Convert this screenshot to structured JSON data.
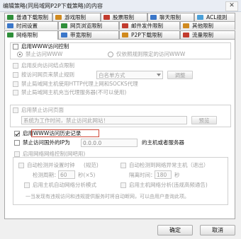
{
  "window": {
    "title": "编辑策略(同局域网P2P下载策略)的内容",
    "close": "✕"
  },
  "tabs_row1": [
    {
      "label": "普通下载限制",
      "color": "#2f8f3a"
    },
    {
      "label": "游戏限制",
      "color": "#d08a1f"
    },
    {
      "label": "股票限制",
      "color": "#c23b2e"
    },
    {
      "label": "聊天限制",
      "color": "#3b77c9"
    },
    {
      "label": "ACL规则",
      "color": "#4aa0d8"
    }
  ],
  "tabs_row2": [
    {
      "label": "时间设置",
      "color": "#3b77c9"
    },
    {
      "label": "网页浏览限制",
      "color": "#2f8f3a"
    },
    {
      "label": "邮件发件限制",
      "color": "#c23b2e"
    },
    {
      "label": "其他限制",
      "color": "#d08a1f"
    }
  ],
  "tabs_row3": [
    {
      "label": "网络限制",
      "color": "#2f8f3a"
    },
    {
      "label": "带宽限制",
      "color": "#3b77c9"
    },
    {
      "label": "P2P下载限制",
      "color": "#d08a1f"
    },
    {
      "label": "流量限制",
      "color": "#c23b2e"
    }
  ],
  "www": {
    "enable_label": "启用WWW访问控制",
    "radio_deny_all": "禁止访问WWW",
    "radio_rules": "仅依照规则限定的访问WWW"
  },
  "options": {
    "reverse_network": "启用反向访问结点限制",
    "web_rules_label": "按访问网页来禁止规则",
    "web_rules_select": "白名单方式",
    "web_rules_button": "调整",
    "block_proxy": "禁止局域网主机使用HTTP代理上网和SOCKS代理",
    "block_proxy_servers": "禁止局域网主机充当代理服务器(不可以使用)"
  },
  "page": {
    "enable_reminder": "启用禁止访问页面",
    "reminder_placeholder": "系统为工作时间，禁止访问此网站！",
    "preview_button": "预览"
  },
  "record": {
    "label": "启用WWW访问历史记录"
  },
  "block_ip": {
    "label": "禁止访问国外的IP为",
    "ip_value": "0.0.0.0",
    "suffix": "的主机或者服务器"
  },
  "monitor": {
    "enable_label": "启用网络网络控制(网吧用)",
    "auto_detect": "自动检测并设置时钟",
    "auto_detect_end": "(规范)",
    "auto_disconnect": "自动检测到网络异常主机（退出）",
    "interval_label": "检测周期：",
    "interval_value": "60",
    "interval_unit": "秒(×5)",
    "disable_label": "隔离时间：",
    "disable_value": "180",
    "disable_unit": "秒",
    "opt_a": "启用主机自动网络分析模式",
    "opt_b": "启用主机网络分析(违规高频通告)",
    "note": "一当发现有违规访问和违规提供服务时将自动断网，可以由用户查询此项。"
  },
  "footer": {
    "ok": "确定",
    "cancel": "取消"
  }
}
